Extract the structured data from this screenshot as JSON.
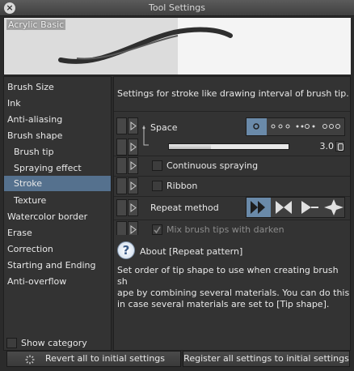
{
  "window": {
    "title": "Tool Settings"
  },
  "preview": {
    "brush_name": "Acrylic Basic"
  },
  "sidebar": {
    "items": [
      "Brush Size",
      "Ink",
      "Anti-aliasing",
      "Brush shape",
      "Brush tip",
      "Spraying effect",
      "Stroke",
      "Texture",
      "Watercolor border",
      "Erase",
      "Correction",
      "Starting and Ending",
      "Anti-overflow"
    ],
    "selected": "Stroke",
    "show_category_label": "Show category"
  },
  "panel": {
    "description": "Settings for stroke like drawing interval of brush tip.",
    "space_label": "Space",
    "space_value": "3.0",
    "continuous_spraying_label": "Continuous spraying",
    "ribbon_label": "Ribbon",
    "repeat_method_label": "Repeat method",
    "mix_label": "Mix brush tips with darken",
    "mix_checked": true
  },
  "about": {
    "title": "About [Repeat pattern]",
    "lines": [
      "Set order of tip shape to use when creating brush sh",
      "ape by combining several materials. You can do this",
      "in case several materials are set to [Tip shape]."
    ]
  },
  "footer": {
    "revert_label": "Revert all to initial settings",
    "register_label": "Register all settings to initial settings"
  },
  "colors": {
    "selection": "#55718e",
    "toggle_selected": "#6a8aa9"
  }
}
